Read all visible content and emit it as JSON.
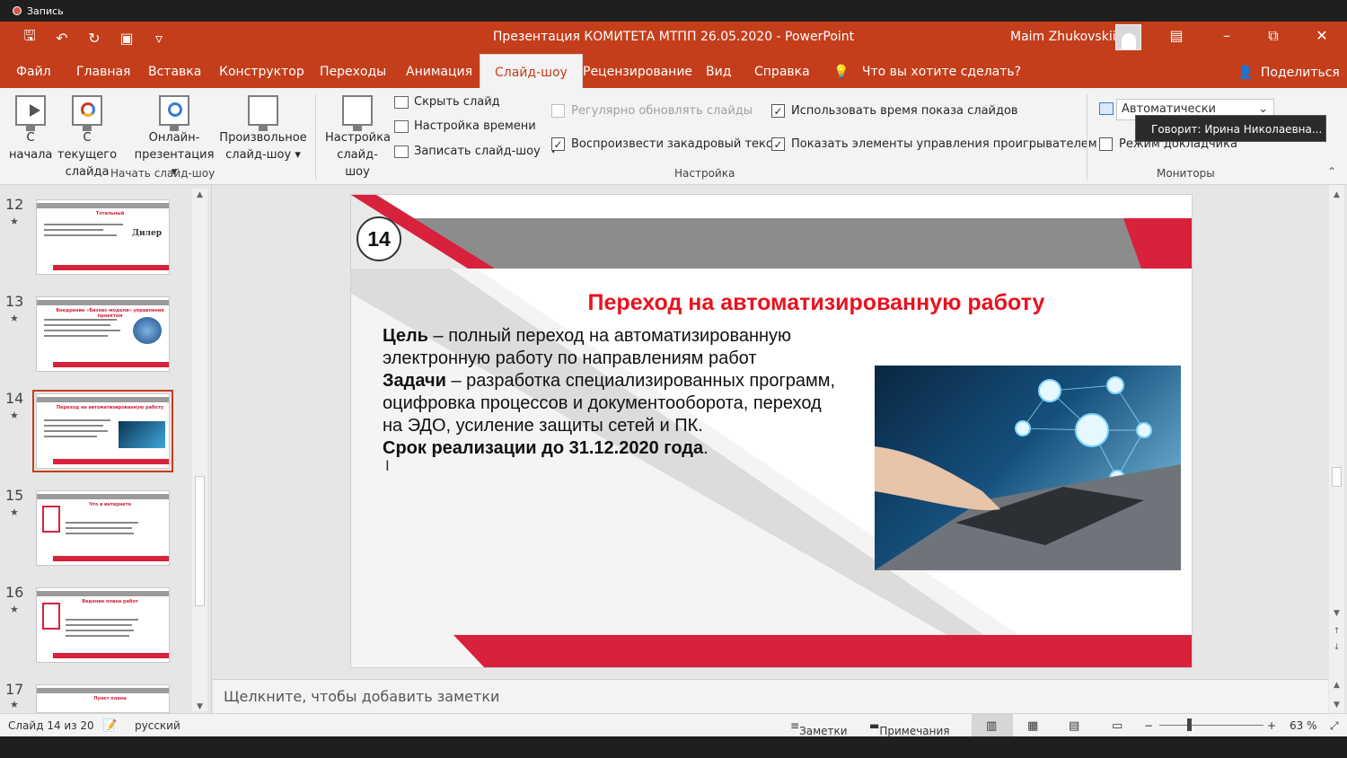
{
  "recording": {
    "label": "Запись"
  },
  "window": {
    "title": "Презентация КОМИТЕТА МТПП 26.05.2020  -  PowerPoint",
    "user": "Maim Zhukovskii"
  },
  "tabs": [
    {
      "label": "Файл"
    },
    {
      "label": "Главная"
    },
    {
      "label": "Вставка"
    },
    {
      "label": "Конструктор"
    },
    {
      "label": "Переходы"
    },
    {
      "label": "Анимация"
    },
    {
      "label": "Слайд-шоу"
    },
    {
      "label": "Рецензирование"
    },
    {
      "label": "Вид"
    },
    {
      "label": "Справка"
    }
  ],
  "tellme": "Что вы хотите сделать?",
  "share": "Поделиться",
  "ribbon": {
    "start_group": "Начать слайд-шоу",
    "from_start": [
      "С",
      "начала"
    ],
    "from_current": [
      "С текущего",
      "слайда"
    ],
    "online": [
      "Онлайн-",
      "презентация ▾"
    ],
    "custom": [
      "Произвольное",
      "слайд-шоу ▾"
    ],
    "setup": [
      "Настройка",
      "слайд-шоу"
    ],
    "hide_slide": "Скрыть слайд",
    "rehearse": "Настройка времени",
    "record": "Записать слайд-шоу",
    "setup_group": "Настройка",
    "keep_updated": "Регулярно обновлять слайды",
    "play_narrations": "Воспроизвести закадровый текст",
    "use_timings": "Использовать время показа слайдов",
    "show_controls": "Показать элементы управления проигрывателем",
    "monitors_group": "Мониторы",
    "monitor_value": "Автоматически",
    "presenter_view": "Режим докладчика"
  },
  "tooltip": "Говорит: Ирина Николаевна...",
  "thumbnails": [
    {
      "num": "12",
      "title": "Тотальный",
      "extra": "Дилер"
    },
    {
      "num": "13",
      "title": "Внедрение «Бизнес-модели» управления проектом",
      "extra": ""
    },
    {
      "num": "14",
      "title": "Переход на автоматизированную работу",
      "extra": ""
    },
    {
      "num": "15",
      "title": "Что в интернете",
      "extra": ""
    },
    {
      "num": "16",
      "title": "Ведение плана работ",
      "extra": ""
    },
    {
      "num": "17",
      "title": "Пункт плана",
      "extra": ""
    }
  ],
  "slide": {
    "number": "14",
    "title": "Переход на автоматизированную работу",
    "goal_label": "Цель",
    "goal_text": " – полный переход на автоматизированную электронную работу по направлениям работ",
    "tasks_label": "Задачи",
    "tasks_text": " – разработка специализированных программ, оцифровка процессов и документооборота, переход на ЭДО, усиление защиты сетей и ПК.",
    "deadline": "Срок реализации до 31.12.2020 года",
    "deadline_dot": "."
  },
  "notes_placeholder": "Щелкните, чтобы добавить заметки",
  "status": {
    "slide_of": "Слайд 14 из 20",
    "language": "русский",
    "notes": "Заметки",
    "comments": "Примечания",
    "zoom": "63 %"
  },
  "colors": {
    "accent": "#c43e1c",
    "slide_red": "#d8213b",
    "slide_gray": "#8c8c8c"
  }
}
